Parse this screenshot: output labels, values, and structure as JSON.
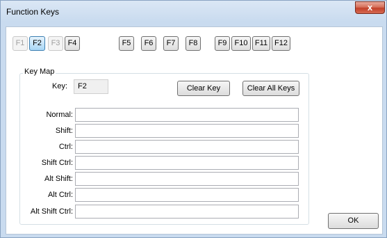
{
  "window": {
    "title": "Function Keys",
    "close_label": "x"
  },
  "fkeys": [
    {
      "label": "F1",
      "state": "disabled"
    },
    {
      "label": "F2",
      "state": "active"
    },
    {
      "label": "F3",
      "state": "disabled"
    },
    {
      "label": "F4",
      "state": "normal"
    },
    {
      "label": "F5",
      "state": "normal"
    },
    {
      "label": "F6",
      "state": "normal"
    },
    {
      "label": "F7",
      "state": "normal"
    },
    {
      "label": "F8",
      "state": "normal"
    },
    {
      "label": "F9",
      "state": "normal"
    },
    {
      "label": "F10",
      "state": "normal"
    },
    {
      "label": "F11",
      "state": "normal"
    },
    {
      "label": "F12",
      "state": "normal"
    }
  ],
  "keymap": {
    "group_label": "Key Map",
    "key_label": "Key:",
    "key_value": "F2",
    "clear_key": "Clear Key",
    "clear_all": "Clear All Keys",
    "rows": [
      {
        "label": "Normal:",
        "value": ""
      },
      {
        "label": "Shift:",
        "value": ""
      },
      {
        "label": "Ctrl:",
        "value": ""
      },
      {
        "label": "Shift Ctrl:",
        "value": ""
      },
      {
        "label": "Alt Shift:",
        "value": ""
      },
      {
        "label": "Alt Ctrl:",
        "value": ""
      },
      {
        "label": "Alt Shift Ctrl:",
        "value": ""
      }
    ]
  },
  "ok_label": "OK"
}
